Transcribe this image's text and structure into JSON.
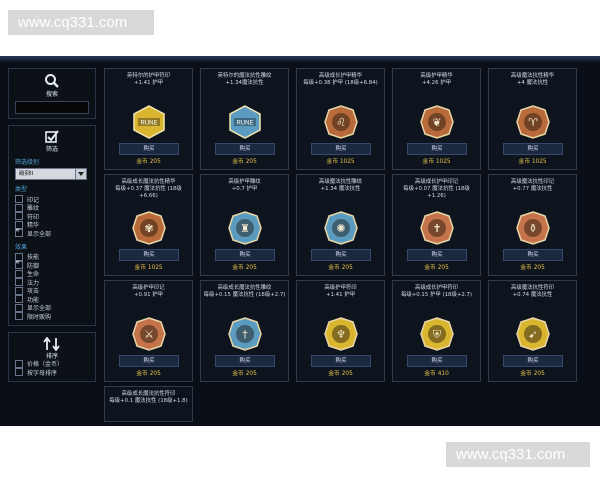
{
  "watermark": {
    "text": "www.cq331.com"
  },
  "sidebar": {
    "search_label": "搜索",
    "filter_label": "筛选",
    "filter_by_label": "筛选级别",
    "tier_select_value": "碳刻II",
    "type_title": "类型",
    "types": [
      {
        "label": "印记",
        "checked": false
      },
      {
        "label": "雕纹",
        "checked": false
      },
      {
        "label": "符印",
        "checked": false
      },
      {
        "label": "精华",
        "checked": false
      },
      {
        "label": "显示全部",
        "checked": true
      }
    ],
    "effect_title": "效果",
    "effects": [
      {
        "label": "技能",
        "checked": false
      },
      {
        "label": "防御",
        "checked": true
      },
      {
        "label": "生命",
        "checked": false
      },
      {
        "label": "法力",
        "checked": false
      },
      {
        "label": "攻击",
        "checked": false
      },
      {
        "label": "功能",
        "checked": false
      },
      {
        "label": "显示全部",
        "checked": false
      },
      {
        "label": "限时贩购",
        "checked": false
      }
    ],
    "sort_label": "排序",
    "sort_options": [
      {
        "label": "价格（金币）",
        "checked": false
      },
      {
        "label": "按字母排序",
        "checked": false
      }
    ]
  },
  "cards": [
    {
      "name1": "英特尔的护甲符印",
      "name2": "+1.41 护甲",
      "buy": "购买",
      "currency": "金币",
      "price": "205",
      "emblem": "yellow-label",
      "color": "#d9b530"
    },
    {
      "name1": "英特尔的魔法抗性雕纹",
      "name2": "+1.34魔法抗性",
      "buy": "购买",
      "currency": "金币",
      "price": "205",
      "emblem": "blue-label",
      "color": "#5b9bc0"
    },
    {
      "name1": "高级成长护甲精华",
      "name2": "每级+0.38 护甲 (18级+6.84)",
      "buy": "购买",
      "currency": "金币",
      "price": "1025",
      "emblem": "lion",
      "color": "#b86a3a"
    },
    {
      "name1": "高级护甲精华",
      "name2": "+4.26 护甲",
      "buy": "购买",
      "currency": "金币",
      "price": "1025",
      "emblem": "dragon",
      "color": "#b86a3a"
    },
    {
      "name1": "高级魔法抗性精华",
      "name2": "+4 魔法抗性",
      "buy": "购买",
      "currency": "金币",
      "price": "1025",
      "emblem": "ram",
      "color": "#b86a3a"
    },
    {
      "name1": "高级成长魔法抗性精华",
      "name2": "每级+0.37 魔法抗性 (18级+6.66)",
      "buy": "购买",
      "currency": "金币",
      "price": "1025",
      "emblem": "tree",
      "color": "#b86a3a"
    },
    {
      "name1": "高级护甲雕纹",
      "name2": "+0.7 护甲",
      "buy": "购买",
      "currency": "金币",
      "price": "205",
      "emblem": "tower",
      "color": "#5b9bc0"
    },
    {
      "name1": "高级魔法抗性雕纹",
      "name2": "+1.34 魔法抗性",
      "buy": "购买",
      "currency": "金币",
      "price": "205",
      "emblem": "swirl",
      "color": "#5b9bc0"
    },
    {
      "name1": "高级成长护甲印记",
      "name2": "每级+0.07 魔法抗性 (18级+1.26)",
      "buy": "购买",
      "currency": "金币",
      "price": "205",
      "emblem": "staff",
      "color": "#c4734a"
    },
    {
      "name1": "高级魔法抗性印记",
      "name2": "+0.77 魔法抗性",
      "buy": "购买",
      "currency": "金币",
      "price": "205",
      "emblem": "flask",
      "color": "#c4734a"
    },
    {
      "name1": "高级护甲印记",
      "name2": "+0.91 护甲",
      "buy": "购买",
      "currency": "金币",
      "price": "205",
      "emblem": "crossed-swords",
      "color": "#c4734a"
    },
    {
      "name1": "高级成长魔法抗性雕纹",
      "name2": "每级+0.15 魔法抗性 (18级+2.7)",
      "buy": "购买",
      "currency": "金币",
      "price": "205",
      "emblem": "sword",
      "color": "#5b9bc0"
    },
    {
      "name1": "高级护甲符印",
      "name2": "+1.41 护甲",
      "buy": "购买",
      "currency": "金币",
      "price": "205",
      "emblem": "goblet",
      "color": "#d9b530"
    },
    {
      "name1": "高级成长护甲符印",
      "name2": "每级+0.15 护甲 (18级+2.7)",
      "buy": "购买",
      "currency": "金币",
      "price": "410",
      "emblem": "shield",
      "color": "#d9b530"
    },
    {
      "name1": "高级魔法抗性符印",
      "name2": "+0.74 魔法抗性",
      "buy": "购买",
      "currency": "金币",
      "price": "205",
      "emblem": "horn",
      "color": "#d9b530"
    },
    {
      "name1": "高级成长魔法抗性符印",
      "name2": "每级+0.1 魔法抗性 (18级+1.8)",
      "buy": "",
      "currency": "",
      "price": "",
      "emblem": "",
      "color": "#d9b530"
    }
  ]
}
